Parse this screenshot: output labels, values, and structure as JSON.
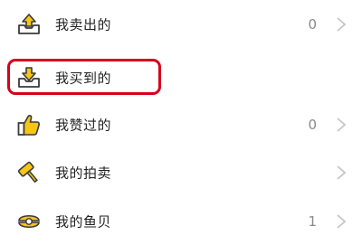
{
  "menu": {
    "items": [
      {
        "label": "我卖出的",
        "count": "0",
        "icon": "sold-box-icon"
      },
      {
        "label": "我买到的",
        "count": "",
        "icon": "bought-box-icon"
      },
      {
        "label": "我赞过的",
        "count": "0",
        "icon": "thumbs-up-icon"
      },
      {
        "label": "我的拍卖",
        "count": "",
        "icon": "auction-hammer-icon"
      },
      {
        "label": "我的鱼贝",
        "count": "1",
        "icon": "shell-coin-icon"
      }
    ],
    "highlighted_item": "我买到的"
  },
  "colors": {
    "icon_yellow": "#f5c518",
    "icon_outline": "#3a3a3a",
    "highlight_red": "#d6001c",
    "chevron_gray": "#c6c6c6",
    "count_gray": "#8a8a8a"
  }
}
